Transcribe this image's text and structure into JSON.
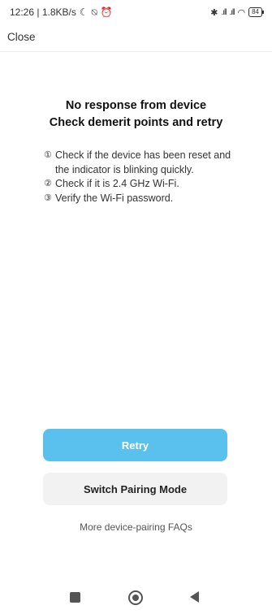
{
  "status_bar": {
    "time_speed": "12:26 | 1.8KB/s",
    "left_icons": [
      "moon-icon",
      "mute-icon",
      "alarm-icon"
    ],
    "left_icon_glyphs": [
      "☾",
      "⍉",
      "⏰"
    ],
    "signal_1": ".ıll",
    "signal_2": ".ıll",
    "bluetooth": "✱",
    "wifi": "◠",
    "battery": "84"
  },
  "top_bar": {
    "close_label": "Close"
  },
  "title": {
    "line1": "No response from device",
    "line2": "Check demerit points and retry"
  },
  "tips": [
    {
      "num": "①",
      "text": "Check if the device has been reset and the indicator is blinking quickly."
    },
    {
      "num": "②",
      "text": "Check if it is 2.4 GHz Wi-Fi."
    },
    {
      "num": "③",
      "text": "Verify the Wi-Fi password."
    }
  ],
  "buttons": {
    "retry": "Retry",
    "switch_mode": "Switch Pairing Mode"
  },
  "faq_link": "More device-pairing FAQs",
  "colors": {
    "accent": "#5ac1ef",
    "secondary_button": "#f2f2f2"
  }
}
